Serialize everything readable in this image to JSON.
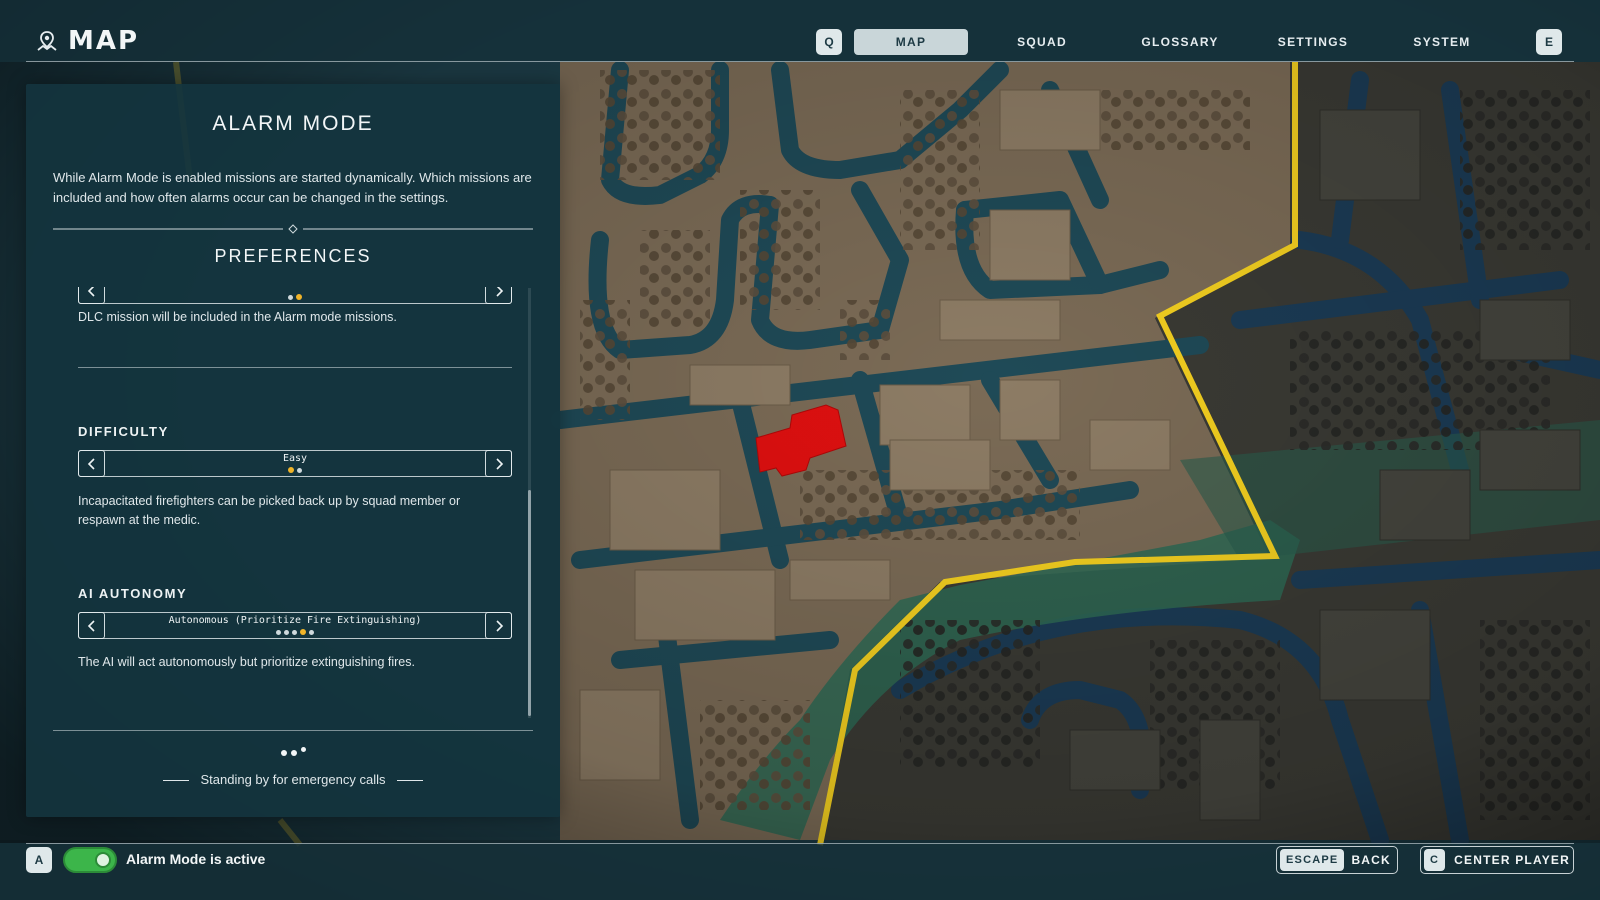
{
  "header": {
    "title": "MAP",
    "left_key": "Q",
    "right_key": "E",
    "tabs": [
      {
        "label": "MAP",
        "active": true
      },
      {
        "label": "SQUAD",
        "active": false
      },
      {
        "label": "GLOSSARY",
        "active": false
      },
      {
        "label": "SETTINGS",
        "active": false
      },
      {
        "label": "SYSTEM",
        "active": false
      }
    ]
  },
  "panel": {
    "title": "ALARM MODE",
    "description": "While Alarm Mode is enabled missions are started dynamically. Which missions are included and how often alarms occur can be changed in the settings.",
    "preferences_title": "PREFERENCES",
    "options": [
      {
        "label": "",
        "value": "",
        "dots": 2,
        "active_dot": 1,
        "description": "DLC mission will be included in the Alarm mode missions."
      },
      {
        "label": "DIFFICULTY",
        "value": "Easy",
        "dots": 2,
        "active_dot": 0,
        "description": "Incapacitated firefighters can be picked back up by squad member or respawn at the medic."
      },
      {
        "label": "AI AUTONOMY",
        "value": "Autonomous (Prioritize Fire Extinguishing)",
        "dots": 5,
        "active_dot": 3,
        "description": "The AI will act autonomously but prioritize extinguishing fires."
      }
    ],
    "status_text": "Standing by for emergency calls"
  },
  "footer": {
    "toggle_key": "A",
    "alarm_mode_active": true,
    "alarm_text": "Alarm Mode is active",
    "back_key": "ESCAPE",
    "back_label": "BACK",
    "center_key": "C",
    "center_label": "CENTER PLAYER"
  },
  "colors": {
    "accent_yellow": "#f0b429",
    "boundary_yellow": "#f4d020",
    "fire_red": "#e01010",
    "toggle_green": "#3cb54a",
    "water": "#1f4a57",
    "land": "#7a6a55"
  }
}
